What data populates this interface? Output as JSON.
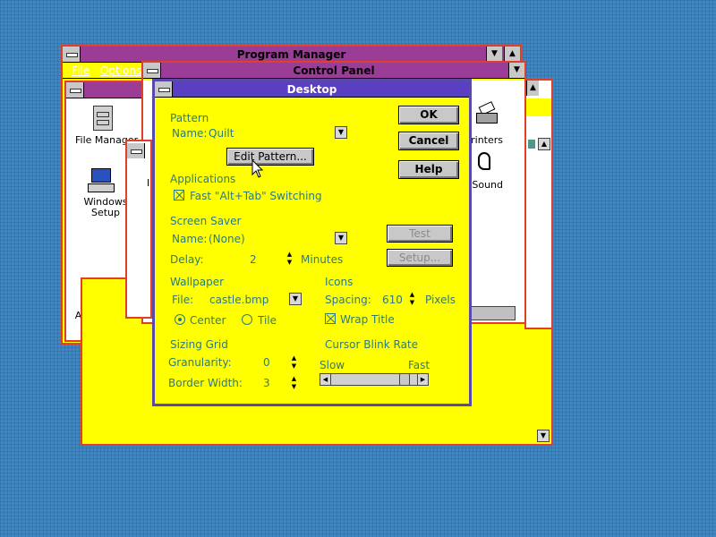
{
  "program_manager": {
    "title": "Program Manager",
    "menu": [
      "File",
      "Options"
    ],
    "icons": [
      "File Manager",
      "Windows Setup",
      "Accessories"
    ]
  },
  "control_panel": {
    "title": "Control Panel",
    "icons": [
      "Printers",
      "Sound"
    ],
    "partial_text": "I"
  },
  "desktop_dialog": {
    "title": "Desktop",
    "pattern": {
      "section": "Pattern",
      "name_label": "Name:",
      "name_value": "Quilt",
      "edit_button": "Edit Pattern..."
    },
    "applications": {
      "section": "Applications",
      "fast_switch_label": "Fast \"Alt+Tab\" Switching",
      "fast_switch_checked": true
    },
    "screen_saver": {
      "section": "Screen Saver",
      "name_label": "Name:",
      "name_value": "(None)",
      "delay_label": "Delay:",
      "delay_value": "2",
      "delay_unit": "Minutes",
      "test_button": "Test",
      "setup_button": "Setup..."
    },
    "wallpaper": {
      "section": "Wallpaper",
      "file_label": "File:",
      "file_value": "castle.bmp",
      "center_label": "Center",
      "tile_label": "Tile",
      "selected": "Center"
    },
    "icons": {
      "section": "Icons",
      "spacing_label": "Spacing:",
      "spacing_value": "610",
      "spacing_unit": "Pixels",
      "wrap_title_label": "Wrap Title",
      "wrap_title_checked": true
    },
    "sizing_grid": {
      "section": "Sizing Grid",
      "granularity_label": "Granularity:",
      "granularity_value": "0",
      "border_width_label": "Border Width:",
      "border_width_value": "3"
    },
    "cursor_blink": {
      "section": "Cursor Blink Rate",
      "slow_label": "Slow",
      "fast_label": "Fast",
      "rate_fraction": 0.9
    },
    "buttons": {
      "ok": "OK",
      "cancel": "Cancel",
      "help": "Help"
    }
  },
  "colors": {
    "window_bg": "#ffff00",
    "active_title": "#5b3fc2",
    "inactive_title": "#9b3c96",
    "frame": "#e0402a",
    "desktop": "#3b87c7",
    "label_text": "#2c7a7b"
  }
}
